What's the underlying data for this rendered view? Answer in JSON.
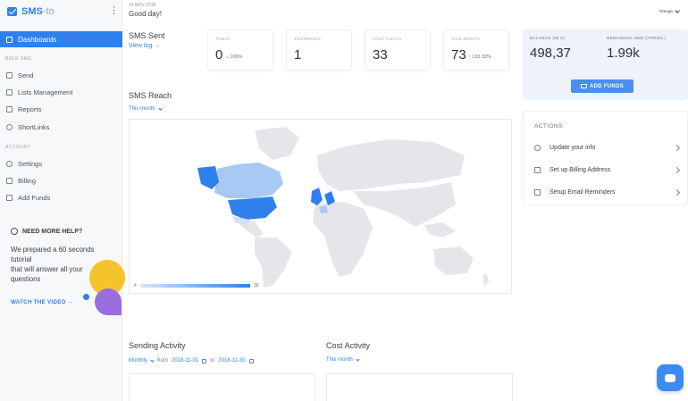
{
  "brand": {
    "name": "SMS",
    "suffix": "-to"
  },
  "header": {
    "date": "19 NOV 2018",
    "greeting": "Good day!",
    "user": "Omega"
  },
  "sidebar": {
    "active": "Dashboards",
    "section_bulk": "BULK SMS",
    "bulk_items": [
      "Send",
      "Lists Management",
      "Reports",
      "ShortLinks"
    ],
    "section_account": "ACCOUNT",
    "account_items": [
      "Settings",
      "Billing",
      "Add Funds"
    ],
    "help": {
      "title": "NEED MORE HELP?",
      "text_lines": [
        "We prepared a 60 seconds",
        "tutorial",
        "that will answer all your",
        "questions"
      ],
      "link": "WATCH THE VIDEO →"
    }
  },
  "sms_sent": {
    "title": "SMS Sent",
    "view_log": "View log →",
    "stats": [
      {
        "label": "TODAY",
        "value": "0",
        "change": "100%",
        "trend": "down"
      },
      {
        "label": "YESTERDAY",
        "value": "1",
        "change": "",
        "trend": ""
      },
      {
        "label": "LAST 7 DAYS",
        "value": "33",
        "change": "",
        "trend": ""
      },
      {
        "label": "THIS MONTH",
        "value": "73",
        "change": "133.33%",
        "trend": "up"
      }
    ]
  },
  "balance": {
    "balance_label": "BALANCE (IN €)",
    "balance_value": "498,37",
    "remaining_label": "REMAINING SMS (APROX.)",
    "remaining_value": "1.99k",
    "add_funds": "ADD FUNDS"
  },
  "actions": {
    "title": "ACTIONS",
    "items": [
      "Update your info",
      "Set up Billing Address",
      "Setup Email Reminders"
    ]
  },
  "sms_reach": {
    "title": "SMS Reach",
    "period": "This month",
    "legend_min": "4",
    "legend_max": "30",
    "highlight_color": "#2f80ed",
    "light_color": "#a9c9f5"
  },
  "sending_activity": {
    "title": "Sending Activity",
    "period": "Monthly",
    "from_label": "from",
    "from_date": "2018-11-01",
    "to_label": "to",
    "to_date": "2018-11-30"
  },
  "cost_activity": {
    "title": "Cost Activity",
    "period": "This month"
  },
  "colors": {
    "accent": "#2f80ed",
    "balance_bg": "#edf2fb"
  }
}
